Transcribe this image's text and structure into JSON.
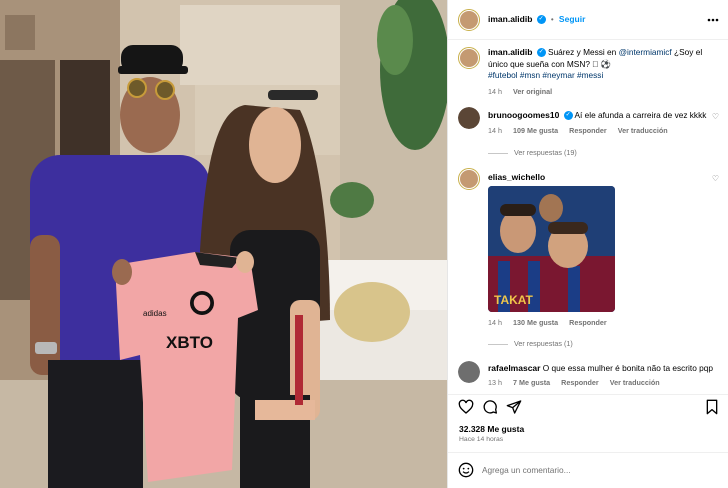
{
  "post": {
    "author": "iman.alidib",
    "follow_label": "Seguir",
    "caption": {
      "author": "iman.alidib",
      "text": "Suárez y Messi en",
      "mention": "@intermiamicf",
      "text2": "¿Soy el único que sueña con MSN? 🏻 ⚽",
      "hashtags": "#futebol #msn #neymar #messi",
      "time": "14 h",
      "see_original": "Ver original"
    },
    "comments": [
      {
        "user": "brunoogoomes10",
        "verified": true,
        "text": "Aí ele afunda a carreira de vez kkkk",
        "time": "14 h",
        "likes": "109 Me gusta",
        "reply": "Responder",
        "translate": "Ver traducción",
        "replies": "Ver respuestas (19)"
      },
      {
        "user": "elias_wichello",
        "time": "14 h",
        "likes": "130 Me gusta",
        "reply": "Responder",
        "replies": "Ver respuestas (1)",
        "gif_text": "TAKAT"
      },
      {
        "user": "rafaelmascar",
        "text": "O que essa mulher é bonita não ta escrito pqp",
        "time": "13 h",
        "likes": "7 Me gusta",
        "reply": "Responder",
        "translate": "Ver traducción"
      }
    ],
    "like_count": "32.328 Me gusta",
    "posted_ago": "Hace 14 horas",
    "comment_placeholder": "Agrega un comentario..."
  },
  "photo": {
    "shirt_sponsor": "XBTO",
    "brand": "adidas"
  },
  "colors": {
    "accent": "#0095f6",
    "muted": "#737373",
    "link": "#00376b",
    "shirt_pink": "#f2a6a6",
    "tshirt_purple": "#3d2f9e"
  },
  "icons": [
    "verified-icon",
    "heart-icon",
    "comment-icon",
    "share-icon",
    "emoji-icon"
  ]
}
